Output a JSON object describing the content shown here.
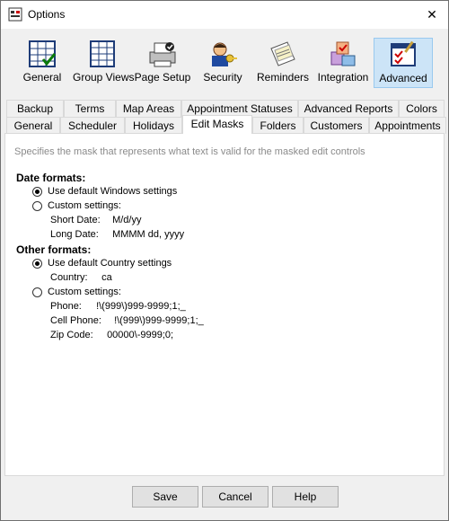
{
  "window": {
    "title": "Options"
  },
  "toolbar": [
    {
      "label": "General",
      "icon": "general-icon"
    },
    {
      "label": "Group Views",
      "icon": "group-views-icon"
    },
    {
      "label": "Page Setup",
      "icon": "page-setup-icon"
    },
    {
      "label": "Security",
      "icon": "security-icon"
    },
    {
      "label": "Reminders",
      "icon": "reminders-icon"
    },
    {
      "label": "Integration",
      "icon": "integration-icon"
    },
    {
      "label": "Advanced",
      "icon": "advanced-icon",
      "active": true
    }
  ],
  "tabs_row1": [
    "Backup",
    "Terms",
    "Map Areas",
    "Appointment Statuses",
    "Advanced Reports",
    "Colors"
  ],
  "tabs_row2": [
    "General",
    "Scheduler",
    "Holidays",
    "Edit Masks",
    "Folders",
    "Customers",
    "Appointments"
  ],
  "selected_tab": "Edit Masks",
  "panel": {
    "description": "Specifies the mask that represents what text is valid for the masked edit controls",
    "date_formats": {
      "heading": "Date formats:",
      "default_option": "Use default Windows settings",
      "custom_option": "Custom settings:",
      "selected": "default",
      "short_label": "Short Date:",
      "short_value": "M/d/yy",
      "long_label": "Long Date:",
      "long_value": "MMMM dd, yyyy"
    },
    "other_formats": {
      "heading": "Other formats:",
      "default_option": "Use default Country settings",
      "country_label": "Country:",
      "country_value": "ca",
      "custom_option": "Custom settings:",
      "selected": "default",
      "phone_label": "Phone:",
      "phone_value": "!\\(999\\)999-9999;1;_",
      "cell_label": "Cell Phone:",
      "cell_value": "!\\(999\\)999-9999;1;_",
      "zip_label": "Zip Code:",
      "zip_value": "00000\\-9999;0;"
    }
  },
  "buttons": {
    "save": "Save",
    "cancel": "Cancel",
    "help": "Help"
  }
}
